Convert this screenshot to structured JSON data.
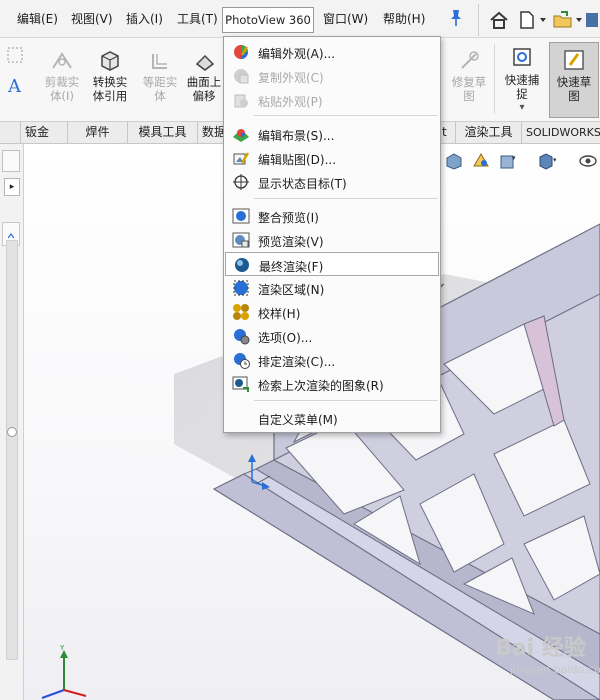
{
  "menubar": {
    "items": [
      {
        "label": "编辑(E)"
      },
      {
        "label": "视图(V)"
      },
      {
        "label": "插入(I)"
      },
      {
        "label": "工具(T)"
      },
      {
        "label": "PhotoView 360"
      },
      {
        "label": "窗口(W)"
      },
      {
        "label": "帮助(H)"
      }
    ]
  },
  "ribbon": {
    "buttons": [
      {
        "label": "剪裁实\n体(I)",
        "enabled": false
      },
      {
        "label": "转换实\n体引用",
        "enabled": true
      },
      {
        "label": "等距实\n体",
        "enabled": false
      },
      {
        "label": "曲面上\n偏移",
        "enabled": true
      },
      {
        "label": "修复草\n图",
        "enabled": false
      },
      {
        "label": "快速捕\n捉",
        "enabled": true
      },
      {
        "label": "快速草\n图",
        "enabled": true,
        "active": true
      }
    ]
  },
  "tabs": [
    {
      "label": "钣金"
    },
    {
      "label": "焊件"
    },
    {
      "label": "模具工具"
    },
    {
      "label": "数据"
    },
    {
      "label": "t"
    },
    {
      "label": "渲染工具"
    },
    {
      "label": "SOLIDWORKS"
    }
  ],
  "dropdown": {
    "items": [
      {
        "label": "编辑外观(A)...",
        "icon": "edit-appearance-icon",
        "enabled": true
      },
      {
        "label": "复制外观(C)",
        "icon": "copy-appearance-icon",
        "enabled": false
      },
      {
        "label": "粘贴外观(P)",
        "icon": "paste-appearance-icon",
        "enabled": false
      },
      {
        "label": "编辑布景(S)...",
        "icon": "edit-scene-icon",
        "enabled": true
      },
      {
        "label": "编辑贴图(D)...",
        "icon": "edit-decal-icon",
        "enabled": true
      },
      {
        "label": "显示状态目标(T)",
        "icon": "target-icon",
        "enabled": true
      },
      {
        "label": "整合预览(I)",
        "icon": "integrated-preview-icon",
        "enabled": true
      },
      {
        "label": "预览渲染(V)",
        "icon": "preview-render-icon",
        "enabled": true
      },
      {
        "label": "最终渲染(F)",
        "icon": "final-render-icon",
        "enabled": true,
        "hover": true
      },
      {
        "label": "渲染区域(N)",
        "icon": "render-region-icon",
        "enabled": true
      },
      {
        "label": "校样(H)",
        "icon": "proof-icon",
        "enabled": true
      },
      {
        "label": "选项(O)...",
        "icon": "options-icon",
        "enabled": true
      },
      {
        "label": "排定渲染(C)...",
        "icon": "schedule-render-icon",
        "enabled": true
      },
      {
        "label": "检索上次渲染的图象(R)",
        "icon": "recall-render-icon",
        "enabled": true
      },
      {
        "label": "自定义菜单(M)",
        "icon": "",
        "enabled": true
      }
    ]
  },
  "watermark": {
    "text": "Bai 经验",
    "sub": "jingyan.baidu.com"
  },
  "colors": {
    "model_face": "#c9c9dc",
    "model_edge": "#6e6e86",
    "model_pink": "#d8c2d8",
    "accent_blue": "#2a6fd6"
  }
}
